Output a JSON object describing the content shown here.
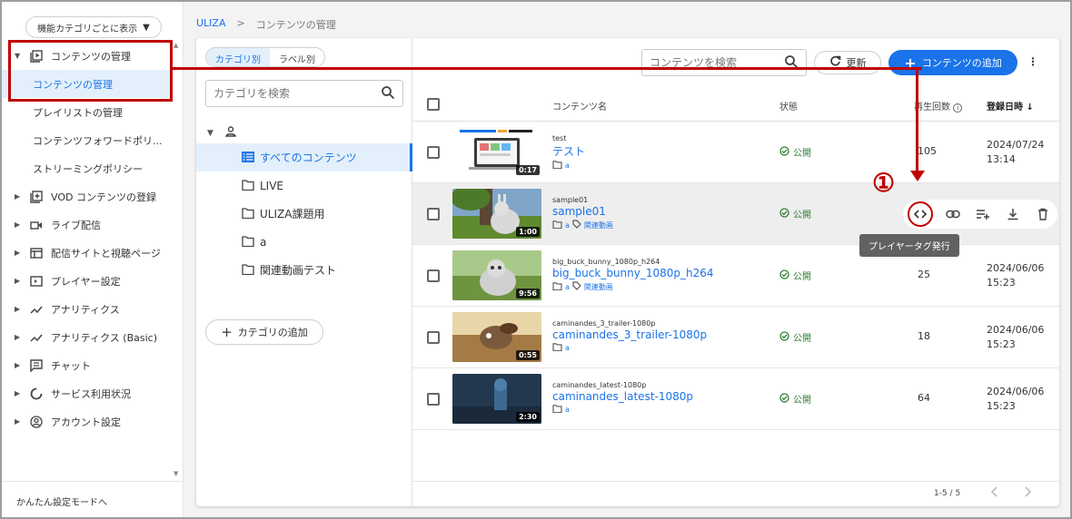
{
  "sidebar": {
    "view_toggle": "機能カテゴリごとに表示",
    "items": [
      {
        "label": "コンテンツの管理",
        "bold": true,
        "expanded": true,
        "icon": "play-library-icon"
      },
      {
        "label": "コンテンツの管理",
        "sub": true,
        "active": true
      },
      {
        "label": "プレイリストの管理",
        "sub": true
      },
      {
        "label": "コンテンツフォワードポリ...",
        "sub": true
      },
      {
        "label": "ストリーミングポリシー",
        "sub": true
      },
      {
        "label": "VOD コンテンツの登録",
        "icon": "add-library-icon"
      },
      {
        "label": "ライブ配信",
        "icon": "videocam-icon"
      },
      {
        "label": "配信サイトと視聴ページ",
        "icon": "web-icon"
      },
      {
        "label": "プレイヤー設定",
        "icon": "player-settings-icon"
      },
      {
        "label": "アナリティクス",
        "icon": "analytics-icon"
      },
      {
        "label": "アナリティクス (Basic)",
        "icon": "analytics-icon"
      },
      {
        "label": "チャット",
        "icon": "chat-icon"
      },
      {
        "label": "サービス利用状況",
        "icon": "usage-icon"
      },
      {
        "label": "アカウント設定",
        "icon": "account-icon"
      }
    ],
    "footer": "かんたん設定モードへ"
  },
  "breadcrumb": {
    "root": "ULIZA",
    "sep": ">",
    "current": "コンテンツの管理"
  },
  "category_panel": {
    "tabs": [
      "カテゴリ別",
      "ラベル別"
    ],
    "search_placeholder": "カテゴリを検索",
    "tree": [
      "すべてのコンテンツ",
      "LIVE",
      "ULIZA課題用",
      "a",
      "関連動画テスト"
    ],
    "add_button": "カテゴリの追加"
  },
  "toolbar": {
    "search_placeholder": "コンテンツを検索",
    "refresh": "更新",
    "add": "コンテンツの追加"
  },
  "table": {
    "headers": {
      "name": "コンテンツ名",
      "status": "状態",
      "plays": "再生回数",
      "date": "登録日時"
    },
    "rows": [
      {
        "subtitle": "test",
        "title": "テスト",
        "folder": "a",
        "tag": "",
        "status": "公開",
        "plays": "105",
        "date": "2024/07/24",
        "time": "13:14",
        "duration": "0:17",
        "thumb": "#dfe6ee"
      },
      {
        "subtitle": "sample01",
        "title": "sample01",
        "folder": "a",
        "tag": "関連動画",
        "status": "公開",
        "plays": "",
        "date": "",
        "time": "",
        "duration": "1:00",
        "thumb": "#6b8f3a"
      },
      {
        "subtitle": "big_buck_bunny_1080p_h264",
        "title": "big_buck_bunny_1080p_h264",
        "folder": "a",
        "tag": "関連動画",
        "status": "公開",
        "plays": "25",
        "date": "2024/06/06",
        "time": "15:23",
        "duration": "9:56",
        "thumb": "#8aa860"
      },
      {
        "subtitle": "caminandes_3_trailer-1080p",
        "title": "caminandes_3_trailer-1080p",
        "folder": "a",
        "tag": "",
        "status": "公開",
        "plays": "18",
        "date": "2024/06/06",
        "time": "15:23",
        "duration": "0:55",
        "thumb": "#c9a46a"
      },
      {
        "subtitle": "caminandes_latest-1080p",
        "title": "caminandes_latest-1080p",
        "folder": "a",
        "tag": "",
        "status": "公開",
        "plays": "64",
        "date": "2024/06/06",
        "time": "15:23",
        "duration": "2:30",
        "thumb": "#2b4a66"
      }
    ]
  },
  "tooltip": "プレイヤータグ発行",
  "pager": {
    "info": "1-5 / 5"
  },
  "annotation": {
    "number": "①"
  },
  "colors": {
    "accent": "#1a73e8",
    "highlight": "#c00000",
    "status_green": "#2e7d32"
  }
}
